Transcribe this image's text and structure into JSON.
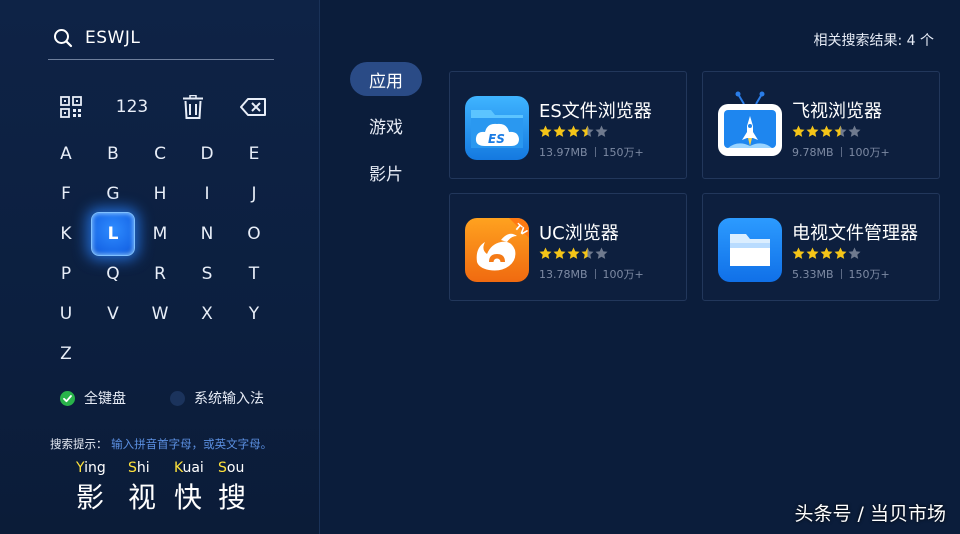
{
  "search": {
    "query": "ESWJL"
  },
  "function_keys": {
    "qr": "qr-code-icon",
    "numbers": "123",
    "clear": "trash-icon",
    "backspace": "backspace-icon"
  },
  "keyboard": {
    "rows": [
      [
        "A",
        "B",
        "C",
        "D",
        "E"
      ],
      [
        "F",
        "G",
        "H",
        "I",
        "J"
      ],
      [
        "K",
        "L",
        "M",
        "N",
        "O"
      ],
      [
        "P",
        "Q",
        "R",
        "S",
        "T"
      ],
      [
        "U",
        "V",
        "W",
        "X",
        "Y"
      ],
      [
        "Z"
      ]
    ],
    "focused": "L"
  },
  "input_mode": {
    "full_keyboard": "全键盘",
    "system_ime": "系统输入法",
    "selected": "full_keyboard"
  },
  "hint": {
    "label": "搜索提示：",
    "text": "输入拼音首字母，或英文字母。"
  },
  "brand": [
    {
      "cap": "Y",
      "rest": "ing",
      "char": "影"
    },
    {
      "cap": "S",
      "rest": "hi",
      "char": "视"
    },
    {
      "cap": "K",
      "rest": "uai",
      "char": "快"
    },
    {
      "cap": "S",
      "rest": "ou",
      "char": "搜"
    }
  ],
  "categories": [
    "应用",
    "游戏",
    "影片"
  ],
  "active_category": "应用",
  "results_label": "相关搜索结果: 4 个",
  "apps": [
    {
      "name": "ES文件浏览器",
      "rating": 3.5,
      "size": "13.97MB",
      "downloads": "150万+",
      "icon": "es-file-explorer-icon"
    },
    {
      "name": "飞视浏览器",
      "rating": 3.5,
      "size": "9.78MB",
      "downloads": "100万+",
      "icon": "feishi-tv-browser-icon"
    },
    {
      "name": "UC浏览器",
      "rating": 3.5,
      "size": "13.78MB",
      "downloads": "100万+",
      "icon": "uc-browser-icon"
    },
    {
      "name": "电视文件管理器",
      "rating": 4,
      "size": "5.33MB",
      "downloads": "150万+",
      "icon": "folder-icon"
    }
  ],
  "watermark": "头条号 / 当贝市场",
  "colors": {
    "background": "#0b1d3b",
    "focus": "#1868e8",
    "star": "#f5c518",
    "check": "#29b34a",
    "pinyin_cap": "#ffe23a"
  }
}
